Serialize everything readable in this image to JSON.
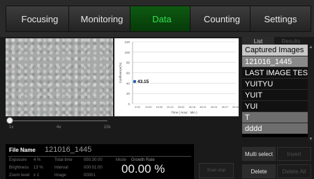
{
  "tabs": [
    {
      "label": "Focusing",
      "active": false
    },
    {
      "label": "Monitoring",
      "active": false
    },
    {
      "label": "Data",
      "active": true
    },
    {
      "label": "Counting",
      "active": false
    },
    {
      "label": "Settings",
      "active": false
    }
  ],
  "slider": {
    "ticks": [
      "1x",
      "4x",
      "10x"
    ]
  },
  "info": {
    "file_name_label": "File Name",
    "file_name": "121016_1445",
    "exposure_label": "Exposure",
    "exposure": "4 %",
    "brightness_label": "Brightness",
    "brightness": "13 %",
    "zoom_label": "Zoom level",
    "zoom": "x 1",
    "total_time_label": "Total time",
    "total_time": "050:30:00",
    "interval_label": "Interval",
    "interval": "000:01:00",
    "image_label": "Image",
    "image": "00001",
    "mode_label": "Mode",
    "mode": "Growth Rate",
    "rate_value": "00.00 %"
  },
  "scan_button": "Scan stop",
  "right_panel": {
    "tab_list": "List",
    "tab_results": "Results",
    "list_header": "Captured Images",
    "items": [
      "121016_1445",
      "LAST IMAGE TEST",
      "YUITYU",
      "YUIT",
      "YUI",
      "T",
      "dddd"
    ],
    "selected_index": 0,
    "multi_select": "Multi select",
    "invert": "Invert",
    "delete": "Delete",
    "delete_all": "Delete All"
  },
  "chart_data": {
    "type": "line",
    "ylabel": "Confluence(%)",
    "xlabel": "Time ( Hour : Min )",
    "yticks": [
      "120",
      "100",
      "80",
      "60",
      "40",
      "20",
      "0"
    ],
    "ylim": [
      0,
      120
    ],
    "xticks": [
      "0:00",
      "10:00",
      "15:00",
      "20:12",
      "25:00",
      "30:18",
      "35:21",
      "40:24",
      "45:27",
      "50:30"
    ],
    "series": [
      {
        "x": [
          "0:00"
        ],
        "y": [
          43.15
        ]
      }
    ],
    "point_label": "43.15",
    "grid": true
  }
}
